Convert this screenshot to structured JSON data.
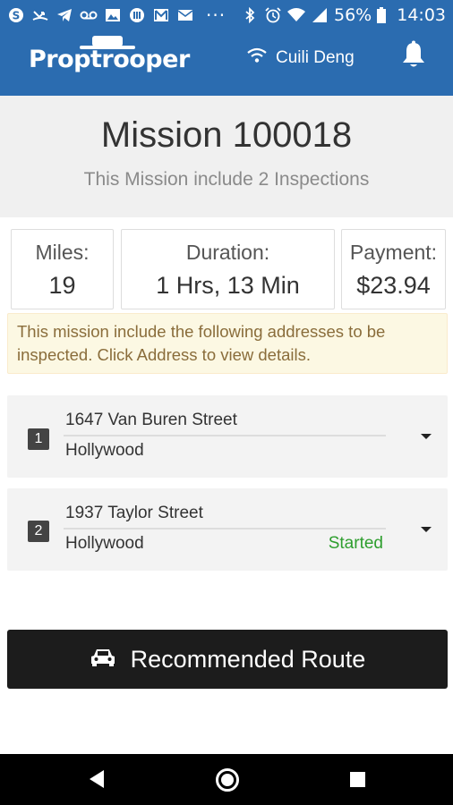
{
  "status_bar": {
    "battery": "56%",
    "time": "14:03",
    "icons": [
      "skype-icon",
      "missed-call-icon",
      "telegram-icon",
      "voicemail-icon",
      "image-icon",
      "media-icon",
      "gmail-icon",
      "mail-icon",
      "more-icon",
      "bluetooth-icon",
      "alarm-icon",
      "wifi-icon",
      "signal-icon",
      "battery-icon"
    ],
    "overflow": "···"
  },
  "app_bar": {
    "logo": "Proptrooper",
    "user_name": "Cuili Deng",
    "bg_color": "#2b6cb0"
  },
  "mission": {
    "title": "Mission 100018",
    "subtitle": "This Mission include 2 Inspections"
  },
  "stats": {
    "miles_label": "Miles:",
    "miles_value": "19",
    "duration_label": "Duration:",
    "duration_value": "1 Hrs, 13 Min",
    "payment_label": "Payment:",
    "payment_value": "$23.94"
  },
  "notice": "This mission include the following addresses to be inspected. Click Address to view details.",
  "addresses": [
    {
      "number": "1",
      "street": "1647 Van Buren Street",
      "city": "Hollywood",
      "status": ""
    },
    {
      "number": "2",
      "street": "1937 Taylor Street",
      "city": "Hollywood",
      "status": "Started"
    }
  ],
  "route_button": "Recommended Route"
}
